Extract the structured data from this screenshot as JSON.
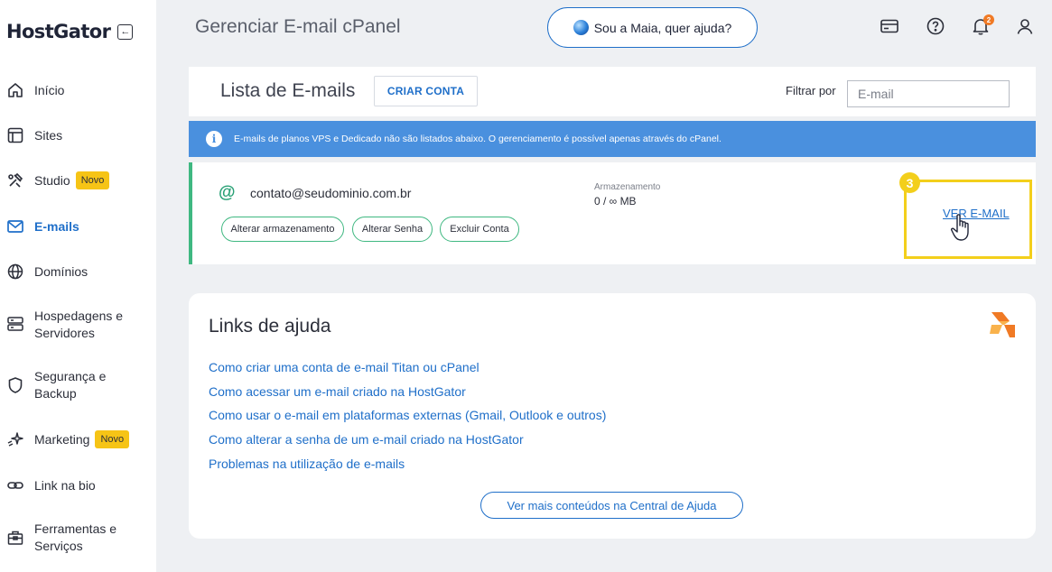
{
  "brand": {
    "name": "HostGator"
  },
  "sidebar": {
    "items": [
      {
        "label": "Início",
        "icon": "home-icon"
      },
      {
        "label": "Sites",
        "icon": "browser-window-icon"
      },
      {
        "label": "Studio",
        "icon": "tools-icon",
        "badge": "Novo"
      },
      {
        "label": "E-mails",
        "icon": "envelope-icon",
        "active": true
      },
      {
        "label": "Domínios",
        "icon": "globe-icon"
      },
      {
        "label": "Hospedagens e Servidores",
        "icon": "server-icon"
      },
      {
        "label": "Segurança e Backup",
        "icon": "shield-icon"
      },
      {
        "label": "Marketing",
        "icon": "sparkle-icon",
        "badge": "Novo"
      },
      {
        "label": "Link na bio",
        "icon": "link-icon"
      },
      {
        "label": "Ferramentas e Serviços",
        "icon": "toolbox-icon"
      }
    ]
  },
  "header": {
    "title": "Gerenciar E-mail cPanel",
    "assistant_button": "Sou a Maia, quer ajuda?",
    "notification_count": "2"
  },
  "email_list": {
    "title": "Lista de E-mails",
    "create_button": "CRIAR CONTA",
    "filter_label": "Filtrar por",
    "filter_placeholder": "E-mail",
    "info_text": "E-mails de planos VPS e Dedicado não são listados abaixo. O gerenciamento é possível apenas através do cPanel.",
    "rows": [
      {
        "address": "contato@seudominio.com.br",
        "actions": [
          "Alterar armazenamento",
          "Alterar Senha",
          "Excluir Conta"
        ],
        "storage_label": "Armazenamento",
        "storage_value": "0 / ∞ MB",
        "view_link": "VER E-MAIL",
        "step_number": "3"
      }
    ]
  },
  "help": {
    "title": "Links de ajuda",
    "links": [
      "Como criar uma conta de e-mail Titan ou cPanel",
      "Como acessar um e-mail criado na HostGator",
      "Como usar o e-mail em plataformas externas (Gmail, Outlook e outros)",
      "Como alterar a senha de um e-mail criado na HostGator",
      "Problemas na utilização de e-mails"
    ],
    "more_button": "Ver mais conteúdos na Central de Ajuda"
  },
  "colors": {
    "accent": "#1f6fc9",
    "info_banner": "#4a90de",
    "success": "#3fb881",
    "highlight": "#f3cf1b",
    "badge": "#f6c416"
  }
}
